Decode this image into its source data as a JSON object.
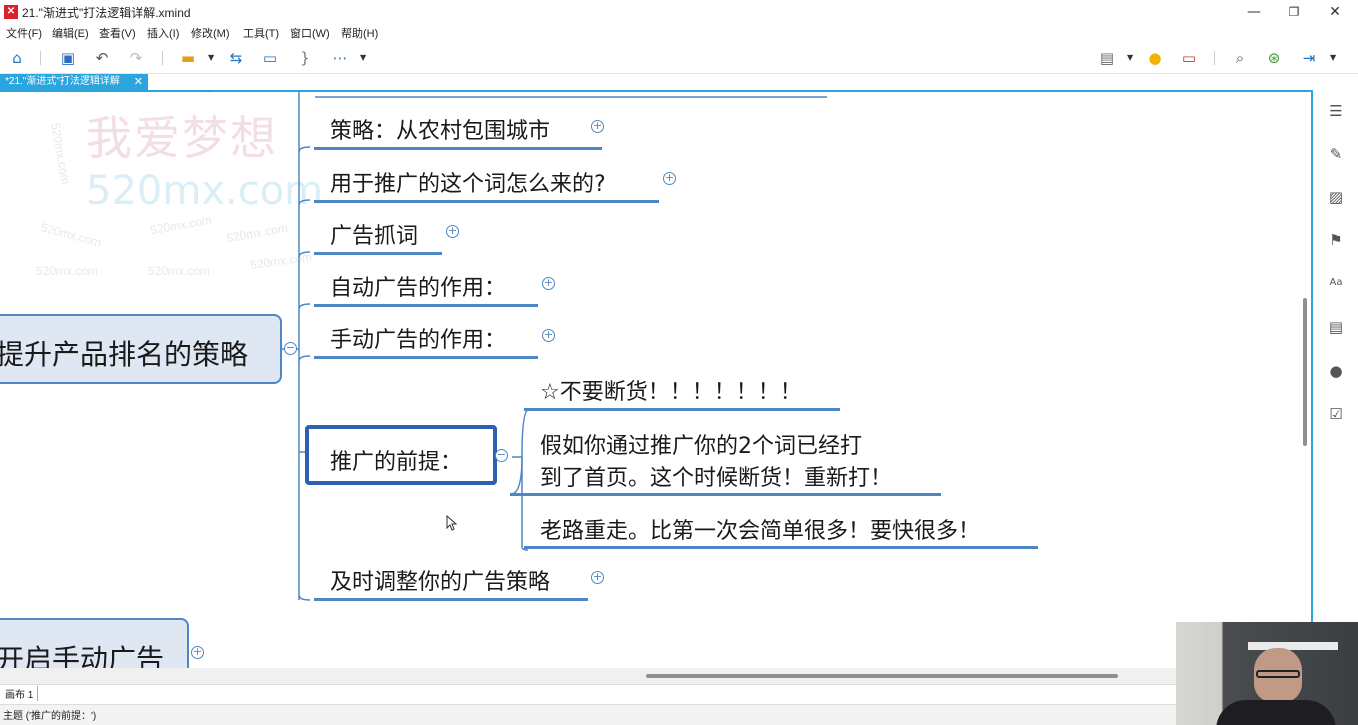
{
  "window": {
    "title": "21.\"渐进式\"打法逻辑详解.xmind",
    "minimize": "—",
    "maximize": "❐",
    "close": "✕"
  },
  "menu": [
    "文件(F)",
    "编辑(E)",
    "查看(V)",
    "插入(I)",
    "修改(M)",
    "工具(T)",
    "窗口(W)",
    "帮助(H)"
  ],
  "tab": {
    "label": "*21.\"渐进式\"打法逻辑详解",
    "close": "✕"
  },
  "watermark": {
    "cn": "我爱梦想",
    "url": "520mx.com",
    "small": "520mx.com"
  },
  "mindmap": {
    "central_left": "提升产品排名的策略",
    "central_bottom": "开启手动广告",
    "branches": [
      "策略：从农村包围城市",
      "用于推广的这个词怎么来的?",
      "广告抓词",
      "自动广告的作用：",
      "手动广告的作用：",
      "推广的前提：",
      "及时调整你的广告策略"
    ],
    "sub_branches": [
      "☆不要断货！！！！！！！",
      "假如你通过推广你的2个词已经打",
      "到了首页。这个时候断货！重新打！",
      "老路重走。比第一次会简单很多！要快很多！"
    ]
  },
  "sheet": {
    "label": "画布 1"
  },
  "status": {
    "text": "主题 ('推广的前提：')"
  },
  "colors": {
    "accent": "#2aa5dd",
    "branch": "#4f86c6",
    "central_fill": "#dfe7f2",
    "selected_border": "#2f5fb0"
  },
  "icons": {
    "toolbar": [
      "home-icon",
      "save-icon",
      "undo-icon",
      "redo-icon",
      "topic-icon",
      "relationship-icon",
      "boundary-icon",
      "summary-icon",
      "more-icon",
      "presentation-icon",
      "idea-icon",
      "outliner-icon",
      "search-icon",
      "share-icon",
      "export-icon"
    ],
    "right_panel": [
      "format-icon",
      "style-icon",
      "image-icon",
      "marker-icon",
      "text-icon",
      "notes-icon",
      "comment-icon",
      "task-icon"
    ]
  }
}
